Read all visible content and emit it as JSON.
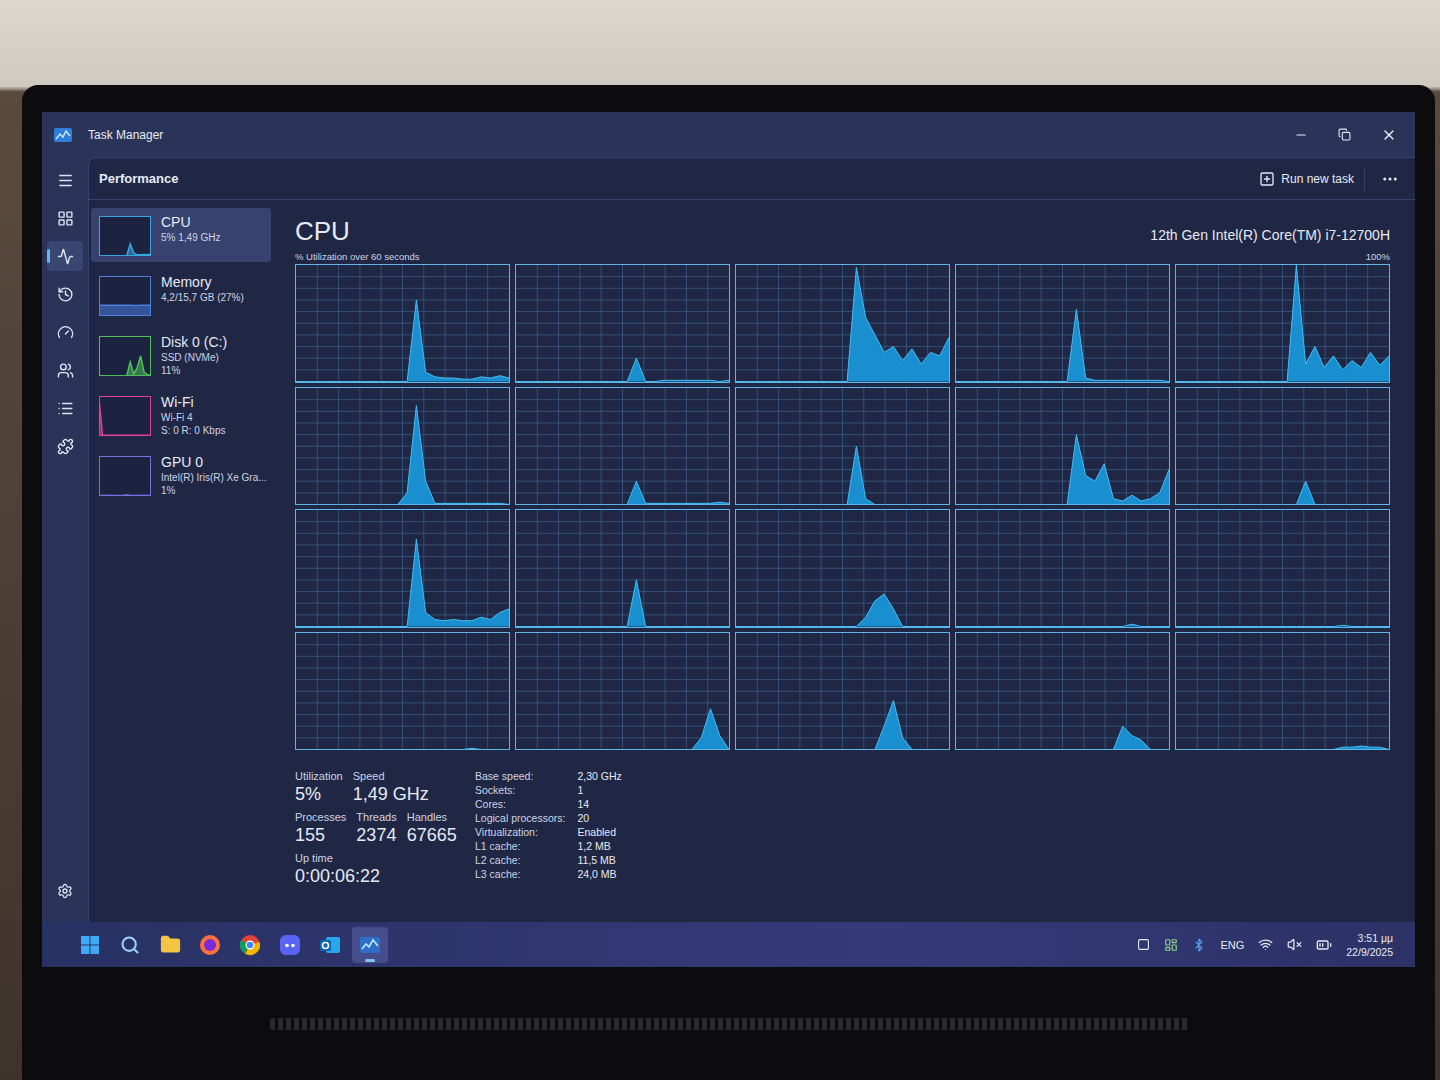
{
  "window": {
    "title": "Task Manager"
  },
  "nav": [
    {
      "selected": false
    },
    {
      "selected": false
    },
    {
      "selected": true
    },
    {
      "selected": false
    },
    {
      "selected": false
    },
    {
      "selected": false
    },
    {
      "selected": false
    },
    {
      "selected": false
    }
  ],
  "header": {
    "title": "Performance",
    "run_new_task": "Run new task"
  },
  "perf_list": [
    {
      "name": "CPU",
      "lines": [
        "5% 1,49 GHz"
      ],
      "selected": true,
      "color": "#3aa6e0",
      "values": [
        0,
        0,
        0,
        0,
        0,
        0,
        0,
        0,
        0,
        30,
        8,
        3,
        3,
        4,
        3,
        5
      ]
    },
    {
      "name": "Memory",
      "lines": [
        "4,2/15,7 GB (27%)"
      ],
      "selected": false,
      "color": "#4a7fe0",
      "values": [
        27,
        27,
        27,
        27,
        27,
        27,
        27,
        27,
        27,
        27,
        26,
        26,
        27,
        27,
        27,
        27
      ]
    },
    {
      "name": "Disk 0 (C:)",
      "lines": [
        "SSD (NVMe)",
        "11%"
      ],
      "selected": false,
      "color": "#4fbf5a",
      "values": [
        0,
        0,
        0,
        0,
        0,
        0,
        0,
        0,
        0,
        35,
        5,
        20,
        50,
        10,
        3,
        2
      ]
    },
    {
      "name": "Wi-Fi",
      "lines": [
        "Wi-Fi 4",
        "S: 0 R: 0 Kbps"
      ],
      "selected": false,
      "color": "#e0409a",
      "values": [
        95,
        2,
        2,
        2,
        2,
        2,
        2,
        2,
        2,
        2,
        2,
        2,
        2,
        2,
        2,
        2
      ]
    },
    {
      "name": "GPU 0",
      "lines": [
        "Intel(R) Iris(R) Xe Gra...",
        "1%"
      ],
      "selected": false,
      "color": "#7a6fe0",
      "values": [
        1,
        1,
        1,
        2,
        1,
        1,
        1,
        1,
        3,
        1,
        1,
        1,
        1,
        2,
        1,
        1
      ]
    }
  ],
  "cpu": {
    "title": "CPU",
    "model": "12th Gen Intel(R) Core(TM) i7-12700H",
    "caption": "% Utilization over 60 seconds",
    "max": "100%",
    "cores": [
      {
        "values": [
          0,
          0,
          0,
          0,
          0,
          0,
          0,
          0,
          0,
          0,
          0,
          0,
          0,
          70,
          8,
          4,
          3,
          3,
          2,
          2,
          4,
          3,
          5,
          3
        ]
      },
      {
        "values": [
          0,
          0,
          0,
          0,
          0,
          0,
          0,
          0,
          0,
          0,
          0,
          0,
          0,
          20,
          0,
          0,
          1,
          1,
          1,
          1,
          1,
          1,
          0,
          1
        ]
      },
      {
        "values": [
          0,
          0,
          0,
          0,
          0,
          0,
          0,
          0,
          0,
          0,
          0,
          0,
          0,
          98,
          55,
          40,
          25,
          30,
          18,
          28,
          15,
          25,
          22,
          38
        ]
      },
      {
        "values": [
          0,
          0,
          0,
          0,
          0,
          0,
          0,
          0,
          0,
          0,
          0,
          0,
          0,
          62,
          3,
          1,
          1,
          1,
          1,
          1,
          1,
          1,
          1,
          0
        ]
      },
      {
        "values": [
          0,
          0,
          0,
          0,
          0,
          0,
          0,
          0,
          0,
          0,
          0,
          0,
          0,
          100,
          15,
          30,
          12,
          22,
          10,
          18,
          12,
          25,
          14,
          22
        ]
      },
      {
        "values": [
          0,
          0,
          0,
          0,
          0,
          0,
          0,
          0,
          0,
          0,
          0,
          0,
          10,
          85,
          20,
          1,
          1,
          1,
          1,
          1,
          1,
          1,
          1,
          0
        ]
      },
      {
        "values": [
          0,
          0,
          0,
          0,
          0,
          0,
          0,
          0,
          0,
          0,
          0,
          0,
          0,
          20,
          1,
          1,
          1,
          1,
          1,
          1,
          1,
          1,
          2,
          1
        ]
      },
      {
        "values": [
          0,
          0,
          0,
          0,
          0,
          0,
          0,
          0,
          0,
          0,
          0,
          0,
          0,
          50,
          5,
          0,
          0,
          0,
          0,
          0,
          0,
          0,
          0,
          0
        ]
      },
      {
        "values": [
          0,
          0,
          0,
          0,
          0,
          0,
          0,
          0,
          0,
          0,
          0,
          0,
          0,
          60,
          25,
          20,
          35,
          5,
          3,
          8,
          3,
          5,
          10,
          30
        ]
      },
      {
        "values": [
          0,
          0,
          0,
          0,
          0,
          0,
          0,
          0,
          0,
          0,
          0,
          0,
          0,
          0,
          20,
          0,
          0,
          0,
          0,
          0,
          0,
          0,
          0,
          0
        ]
      },
      {
        "values": [
          0,
          0,
          0,
          0,
          0,
          0,
          0,
          0,
          0,
          0,
          0,
          0,
          0,
          75,
          12,
          6,
          5,
          6,
          5,
          5,
          8,
          6,
          12,
          15
        ]
      },
      {
        "values": [
          0,
          0,
          0,
          0,
          0,
          0,
          0,
          0,
          0,
          0,
          0,
          0,
          0,
          40,
          0,
          0,
          0,
          0,
          0,
          0,
          0,
          0,
          0,
          0
        ]
      },
      {
        "values": [
          0,
          0,
          0,
          0,
          0,
          0,
          0,
          0,
          0,
          0,
          0,
          0,
          0,
          0,
          8,
          22,
          28,
          15,
          0,
          0,
          0,
          0,
          0,
          0
        ]
      },
      {
        "values": [
          0,
          0,
          0,
          0,
          0,
          0,
          0,
          0,
          0,
          0,
          0,
          0,
          0,
          0,
          0,
          0,
          0,
          0,
          0,
          2,
          0,
          0,
          0,
          0
        ]
      },
      {
        "values": [
          0,
          0,
          0,
          0,
          0,
          0,
          0,
          0,
          0,
          0,
          0,
          0,
          0,
          0,
          0,
          0,
          0,
          0,
          1,
          0,
          0,
          0,
          0,
          0
        ]
      },
      {
        "values": [
          0,
          0,
          0,
          0,
          0,
          0,
          0,
          0,
          0,
          0,
          0,
          0,
          0,
          0,
          0,
          0,
          0,
          0,
          0,
          1,
          0,
          0,
          0,
          0
        ]
      },
      {
        "values": [
          0,
          0,
          0,
          0,
          0,
          0,
          0,
          0,
          0,
          0,
          0,
          0,
          0,
          0,
          0,
          0,
          0,
          0,
          0,
          0,
          10,
          35,
          12,
          0
        ]
      },
      {
        "values": [
          0,
          0,
          0,
          0,
          0,
          0,
          0,
          0,
          0,
          0,
          0,
          0,
          0,
          0,
          0,
          0,
          20,
          42,
          10,
          0,
          0,
          0,
          0,
          0
        ]
      },
      {
        "values": [
          0,
          0,
          0,
          0,
          0,
          0,
          0,
          0,
          0,
          0,
          0,
          0,
          0,
          0,
          0,
          0,
          0,
          0,
          20,
          12,
          8,
          0,
          0,
          0
        ]
      },
      {
        "values": [
          0,
          0,
          0,
          0,
          0,
          0,
          0,
          0,
          0,
          0,
          0,
          0,
          0,
          0,
          0,
          0,
          0,
          0,
          2,
          2,
          3,
          2,
          2,
          0
        ]
      }
    ]
  },
  "stats": {
    "main": [
      [
        {
          "label": "Utilization",
          "value": "5%"
        },
        {
          "label": "Speed",
          "value": "1,49 GHz"
        }
      ],
      [
        {
          "label": "Processes",
          "value": "155"
        },
        {
          "label": "Threads",
          "value": "2374"
        },
        {
          "label": "Handles",
          "value": "67665"
        }
      ],
      [
        {
          "label": "Up time",
          "value": "0:00:06:22"
        }
      ]
    ],
    "details": [
      {
        "label": "Base speed:",
        "value": "2,30 GHz"
      },
      {
        "label": "Sockets:",
        "value": "1"
      },
      {
        "label": "Cores:",
        "value": "14"
      },
      {
        "label": "Logical processors:",
        "value": "20"
      },
      {
        "label": "Virtualization:",
        "value": "Enabled"
      },
      {
        "label": "L1 cache:",
        "value": "1,2 MB"
      },
      {
        "label": "L2 cache:",
        "value": "11,5 MB"
      },
      {
        "label": "L3 cache:",
        "value": "24,0 MB"
      }
    ]
  },
  "taskbar": {
    "apps": [
      {
        "active": false
      },
      {
        "active": false
      },
      {
        "active": false
      },
      {
        "active": false
      },
      {
        "active": false
      },
      {
        "active": false
      },
      {
        "active": false
      },
      {
        "active": true
      }
    ],
    "language": "ENG",
    "time": "3:51 μμ",
    "date": "22/9/2025"
  }
}
